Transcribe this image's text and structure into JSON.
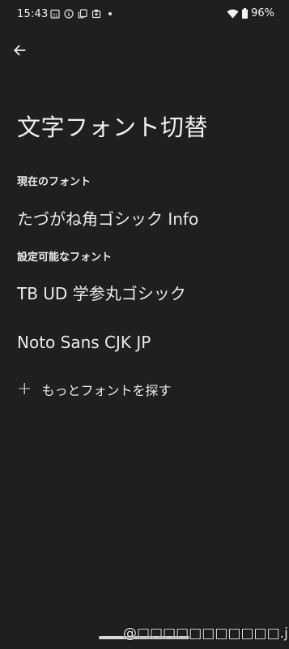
{
  "status_bar": {
    "time": "15:43",
    "battery": "96%",
    "icons": [
      "calendar-icon",
      "info-icon",
      "copy-icon",
      "notification-icon",
      "dot-icon",
      "wifi-icon",
      "battery-icon"
    ]
  },
  "header": {
    "title": "文字フォント切替"
  },
  "current_section": {
    "label": "現在のフォント",
    "font": "たづがね角ゴシック Info"
  },
  "available_section": {
    "label": "設定可能なフォント",
    "fonts": [
      "TB UD 学参丸ゴシック",
      "Noto Sans CJK JP"
    ]
  },
  "more_fonts": {
    "label": "もっとフォントを探す"
  },
  "watermark": {
    "text": "@□□□□□□□□□□□.jp"
  }
}
